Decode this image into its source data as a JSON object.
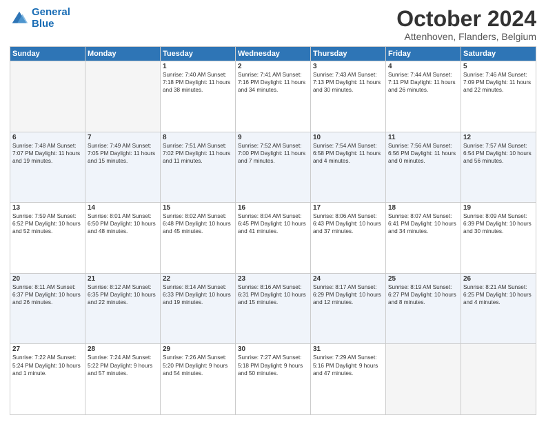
{
  "logo": {
    "line1": "General",
    "line2": "Blue"
  },
  "title": "October 2024",
  "subtitle": "Attenhoven, Flanders, Belgium",
  "days_of_week": [
    "Sunday",
    "Monday",
    "Tuesday",
    "Wednesday",
    "Thursday",
    "Friday",
    "Saturday"
  ],
  "weeks": [
    [
      {
        "day": "",
        "info": ""
      },
      {
        "day": "",
        "info": ""
      },
      {
        "day": "1",
        "info": "Sunrise: 7:40 AM\nSunset: 7:18 PM\nDaylight: 11 hours and 38 minutes."
      },
      {
        "day": "2",
        "info": "Sunrise: 7:41 AM\nSunset: 7:16 PM\nDaylight: 11 hours and 34 minutes."
      },
      {
        "day": "3",
        "info": "Sunrise: 7:43 AM\nSunset: 7:13 PM\nDaylight: 11 hours and 30 minutes."
      },
      {
        "day": "4",
        "info": "Sunrise: 7:44 AM\nSunset: 7:11 PM\nDaylight: 11 hours and 26 minutes."
      },
      {
        "day": "5",
        "info": "Sunrise: 7:46 AM\nSunset: 7:09 PM\nDaylight: 11 hours and 22 minutes."
      }
    ],
    [
      {
        "day": "6",
        "info": "Sunrise: 7:48 AM\nSunset: 7:07 PM\nDaylight: 11 hours and 19 minutes."
      },
      {
        "day": "7",
        "info": "Sunrise: 7:49 AM\nSunset: 7:05 PM\nDaylight: 11 hours and 15 minutes."
      },
      {
        "day": "8",
        "info": "Sunrise: 7:51 AM\nSunset: 7:02 PM\nDaylight: 11 hours and 11 minutes."
      },
      {
        "day": "9",
        "info": "Sunrise: 7:52 AM\nSunset: 7:00 PM\nDaylight: 11 hours and 7 minutes."
      },
      {
        "day": "10",
        "info": "Sunrise: 7:54 AM\nSunset: 6:58 PM\nDaylight: 11 hours and 4 minutes."
      },
      {
        "day": "11",
        "info": "Sunrise: 7:56 AM\nSunset: 6:56 PM\nDaylight: 11 hours and 0 minutes."
      },
      {
        "day": "12",
        "info": "Sunrise: 7:57 AM\nSunset: 6:54 PM\nDaylight: 10 hours and 56 minutes."
      }
    ],
    [
      {
        "day": "13",
        "info": "Sunrise: 7:59 AM\nSunset: 6:52 PM\nDaylight: 10 hours and 52 minutes."
      },
      {
        "day": "14",
        "info": "Sunrise: 8:01 AM\nSunset: 6:50 PM\nDaylight: 10 hours and 48 minutes."
      },
      {
        "day": "15",
        "info": "Sunrise: 8:02 AM\nSunset: 6:48 PM\nDaylight: 10 hours and 45 minutes."
      },
      {
        "day": "16",
        "info": "Sunrise: 8:04 AM\nSunset: 6:45 PM\nDaylight: 10 hours and 41 minutes."
      },
      {
        "day": "17",
        "info": "Sunrise: 8:06 AM\nSunset: 6:43 PM\nDaylight: 10 hours and 37 minutes."
      },
      {
        "day": "18",
        "info": "Sunrise: 8:07 AM\nSunset: 6:41 PM\nDaylight: 10 hours and 34 minutes."
      },
      {
        "day": "19",
        "info": "Sunrise: 8:09 AM\nSunset: 6:39 PM\nDaylight: 10 hours and 30 minutes."
      }
    ],
    [
      {
        "day": "20",
        "info": "Sunrise: 8:11 AM\nSunset: 6:37 PM\nDaylight: 10 hours and 26 minutes."
      },
      {
        "day": "21",
        "info": "Sunrise: 8:12 AM\nSunset: 6:35 PM\nDaylight: 10 hours and 22 minutes."
      },
      {
        "day": "22",
        "info": "Sunrise: 8:14 AM\nSunset: 6:33 PM\nDaylight: 10 hours and 19 minutes."
      },
      {
        "day": "23",
        "info": "Sunrise: 8:16 AM\nSunset: 6:31 PM\nDaylight: 10 hours and 15 minutes."
      },
      {
        "day": "24",
        "info": "Sunrise: 8:17 AM\nSunset: 6:29 PM\nDaylight: 10 hours and 12 minutes."
      },
      {
        "day": "25",
        "info": "Sunrise: 8:19 AM\nSunset: 6:27 PM\nDaylight: 10 hours and 8 minutes."
      },
      {
        "day": "26",
        "info": "Sunrise: 8:21 AM\nSunset: 6:25 PM\nDaylight: 10 hours and 4 minutes."
      }
    ],
    [
      {
        "day": "27",
        "info": "Sunrise: 7:22 AM\nSunset: 5:24 PM\nDaylight: 10 hours and 1 minute."
      },
      {
        "day": "28",
        "info": "Sunrise: 7:24 AM\nSunset: 5:22 PM\nDaylight: 9 hours and 57 minutes."
      },
      {
        "day": "29",
        "info": "Sunrise: 7:26 AM\nSunset: 5:20 PM\nDaylight: 9 hours and 54 minutes."
      },
      {
        "day": "30",
        "info": "Sunrise: 7:27 AM\nSunset: 5:18 PM\nDaylight: 9 hours and 50 minutes."
      },
      {
        "day": "31",
        "info": "Sunrise: 7:29 AM\nSunset: 5:16 PM\nDaylight: 9 hours and 47 minutes."
      },
      {
        "day": "",
        "info": ""
      },
      {
        "day": "",
        "info": ""
      }
    ]
  ]
}
